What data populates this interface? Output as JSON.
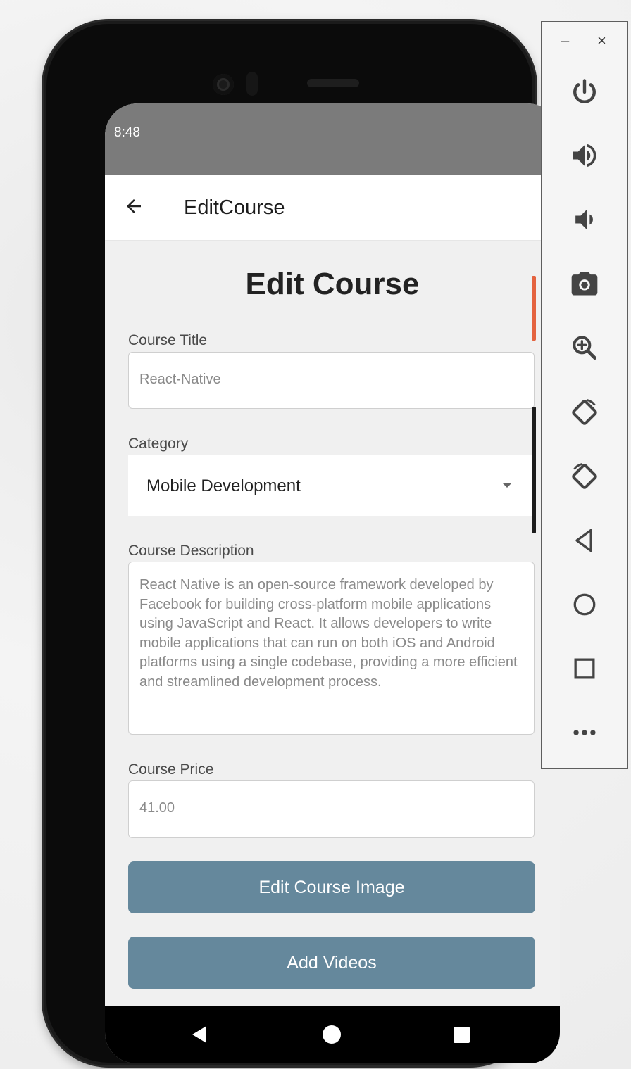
{
  "status_bar": {
    "time": "8:48"
  },
  "header": {
    "title": "EditCourse",
    "back_icon": "arrow-left-icon"
  },
  "form": {
    "page_title": "Edit Course",
    "course_title": {
      "label": "Course Title",
      "value": "React-Native"
    },
    "category": {
      "label": "Category",
      "selected": "Mobile Development"
    },
    "description": {
      "label": "Course Description",
      "value": "React Native is an open-source framework developed by Facebook for building cross-platform mobile applications using JavaScript and React. It allows developers to write mobile applications that can run on both iOS and Android platforms using a single codebase, providing a more efficient and streamlined development process."
    },
    "price": {
      "label": "Course Price",
      "value": "41.00"
    },
    "edit_image_button": "Edit Course Image",
    "add_videos_button": "Add Videos"
  },
  "nav_bar": {
    "icons": [
      "nav-back-icon",
      "nav-home-icon",
      "nav-recent-icon"
    ]
  },
  "emulator_toolbar": {
    "minimize": "–",
    "close": "×",
    "buttons": [
      "power-icon",
      "volume-up-icon",
      "volume-down-icon",
      "camera-icon",
      "zoom-icon",
      "rotate-left-icon",
      "rotate-right-icon",
      "back-icon",
      "home-icon",
      "overview-icon",
      "more-icon"
    ]
  },
  "colors": {
    "button_bg": "#65889c",
    "status_bar": "#7b7b7b",
    "screen_bg": "#f0f0f0"
  }
}
